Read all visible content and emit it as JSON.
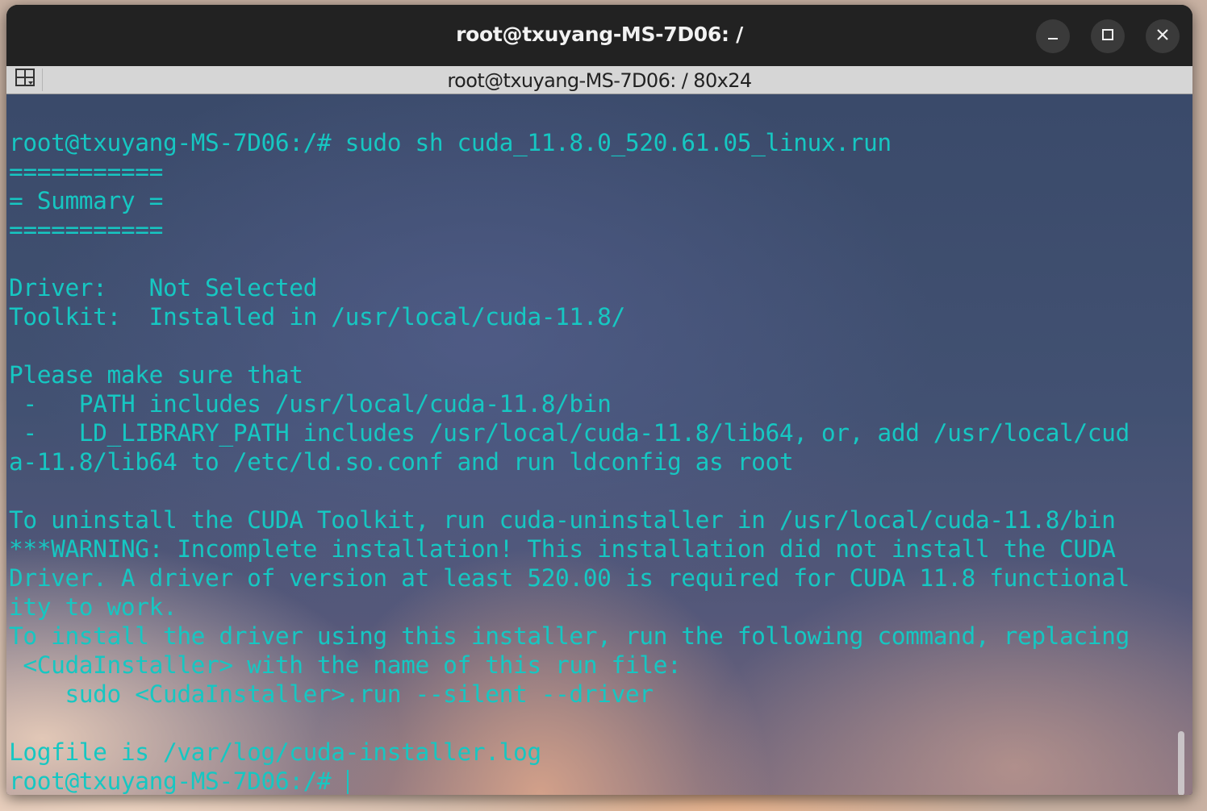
{
  "window": {
    "title": "root@txuyang-MS-7D06: /",
    "subtitle": "root@txuyang-MS-7D06: / 80x24"
  },
  "icons": {
    "minimize": "minimize-icon",
    "maximize": "maximize-icon",
    "close": "close-icon",
    "layout": "layout-grid-icon"
  },
  "colors": {
    "terminal_text": "#16c7c2",
    "titlebar": "#222222",
    "subbar": "#d6d6d6"
  },
  "terminal": {
    "lines": [
      "root@txuyang-MS-7D06:/# sudo sh cuda_11.8.0_520.61.05_linux.run",
      "===========",
      "= Summary =",
      "===========",
      "",
      "Driver:   Not Selected",
      "Toolkit:  Installed in /usr/local/cuda-11.8/",
      "",
      "Please make sure that",
      " -   PATH includes /usr/local/cuda-11.8/bin",
      " -   LD_LIBRARY_PATH includes /usr/local/cuda-11.8/lib64, or, add /usr/local/cud",
      "a-11.8/lib64 to /etc/ld.so.conf and run ldconfig as root",
      "",
      "To uninstall the CUDA Toolkit, run cuda-uninstaller in /usr/local/cuda-11.8/bin",
      "***WARNING: Incomplete installation! This installation did not install the CUDA",
      "Driver. A driver of version at least 520.00 is required for CUDA 11.8 functional",
      "ity to work.",
      "To install the driver using this installer, run the following command, replacing",
      " <CudaInstaller> with the name of this run file:",
      "    sudo <CudaInstaller>.run --silent --driver",
      "",
      "Logfile is /var/log/cuda-installer.log"
    ],
    "prompt": "root@txuyang-MS-7D06:/# "
  }
}
